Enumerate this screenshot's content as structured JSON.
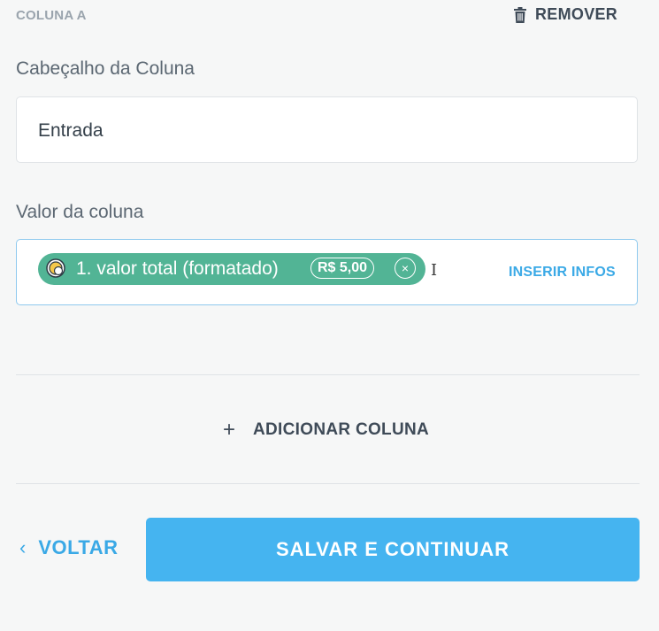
{
  "column": {
    "label": "COLUNA A",
    "remove_label": "REMOVER",
    "remove_icon": "trash-icon"
  },
  "header_field": {
    "label": "Cabeçalho da Coluna",
    "value": "Entrada"
  },
  "value_field": {
    "label": "Valor da coluna",
    "chip": {
      "icon": "coin-icon",
      "text": "1. valor total (formatado)",
      "price": "R$ 5,00",
      "close_glyph": "×"
    },
    "cursor_glyph": "I",
    "insert_label": "INSERIR INFOS"
  },
  "add_column": {
    "plus": "+",
    "label": "ADICIONAR COLUNA"
  },
  "footer": {
    "back_chevron": "‹",
    "back_label": "VOLTAR",
    "save_label": "SALVAR E CONTINUAR"
  },
  "colors": {
    "accent": "#45b4f0",
    "chip": "#52b495",
    "background": "#f6f7f7"
  }
}
